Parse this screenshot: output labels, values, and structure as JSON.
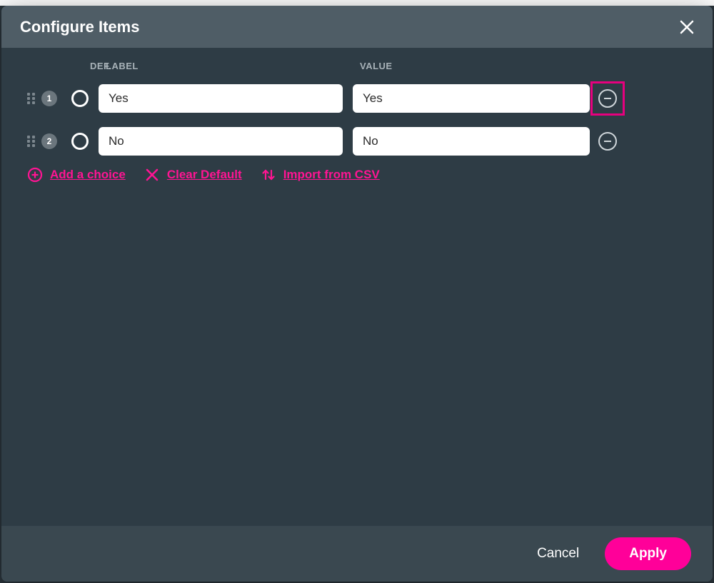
{
  "dialog": {
    "title": "Configure Items",
    "headers": {
      "def": "DEF.",
      "label": "LABEL",
      "value": "VALUE"
    },
    "items": [
      {
        "index": "1",
        "label": "Yes",
        "value": "Yes",
        "highlight_remove": true
      },
      {
        "index": "2",
        "label": "No",
        "value": "No",
        "highlight_remove": false
      }
    ],
    "actions": {
      "add": "Add a choice",
      "clear": "Clear Default",
      "import": "Import from CSV"
    },
    "footer": {
      "cancel": "Cancel",
      "apply": "Apply"
    }
  },
  "colors": {
    "accent": "#ff0099",
    "link": "#ff1493"
  }
}
